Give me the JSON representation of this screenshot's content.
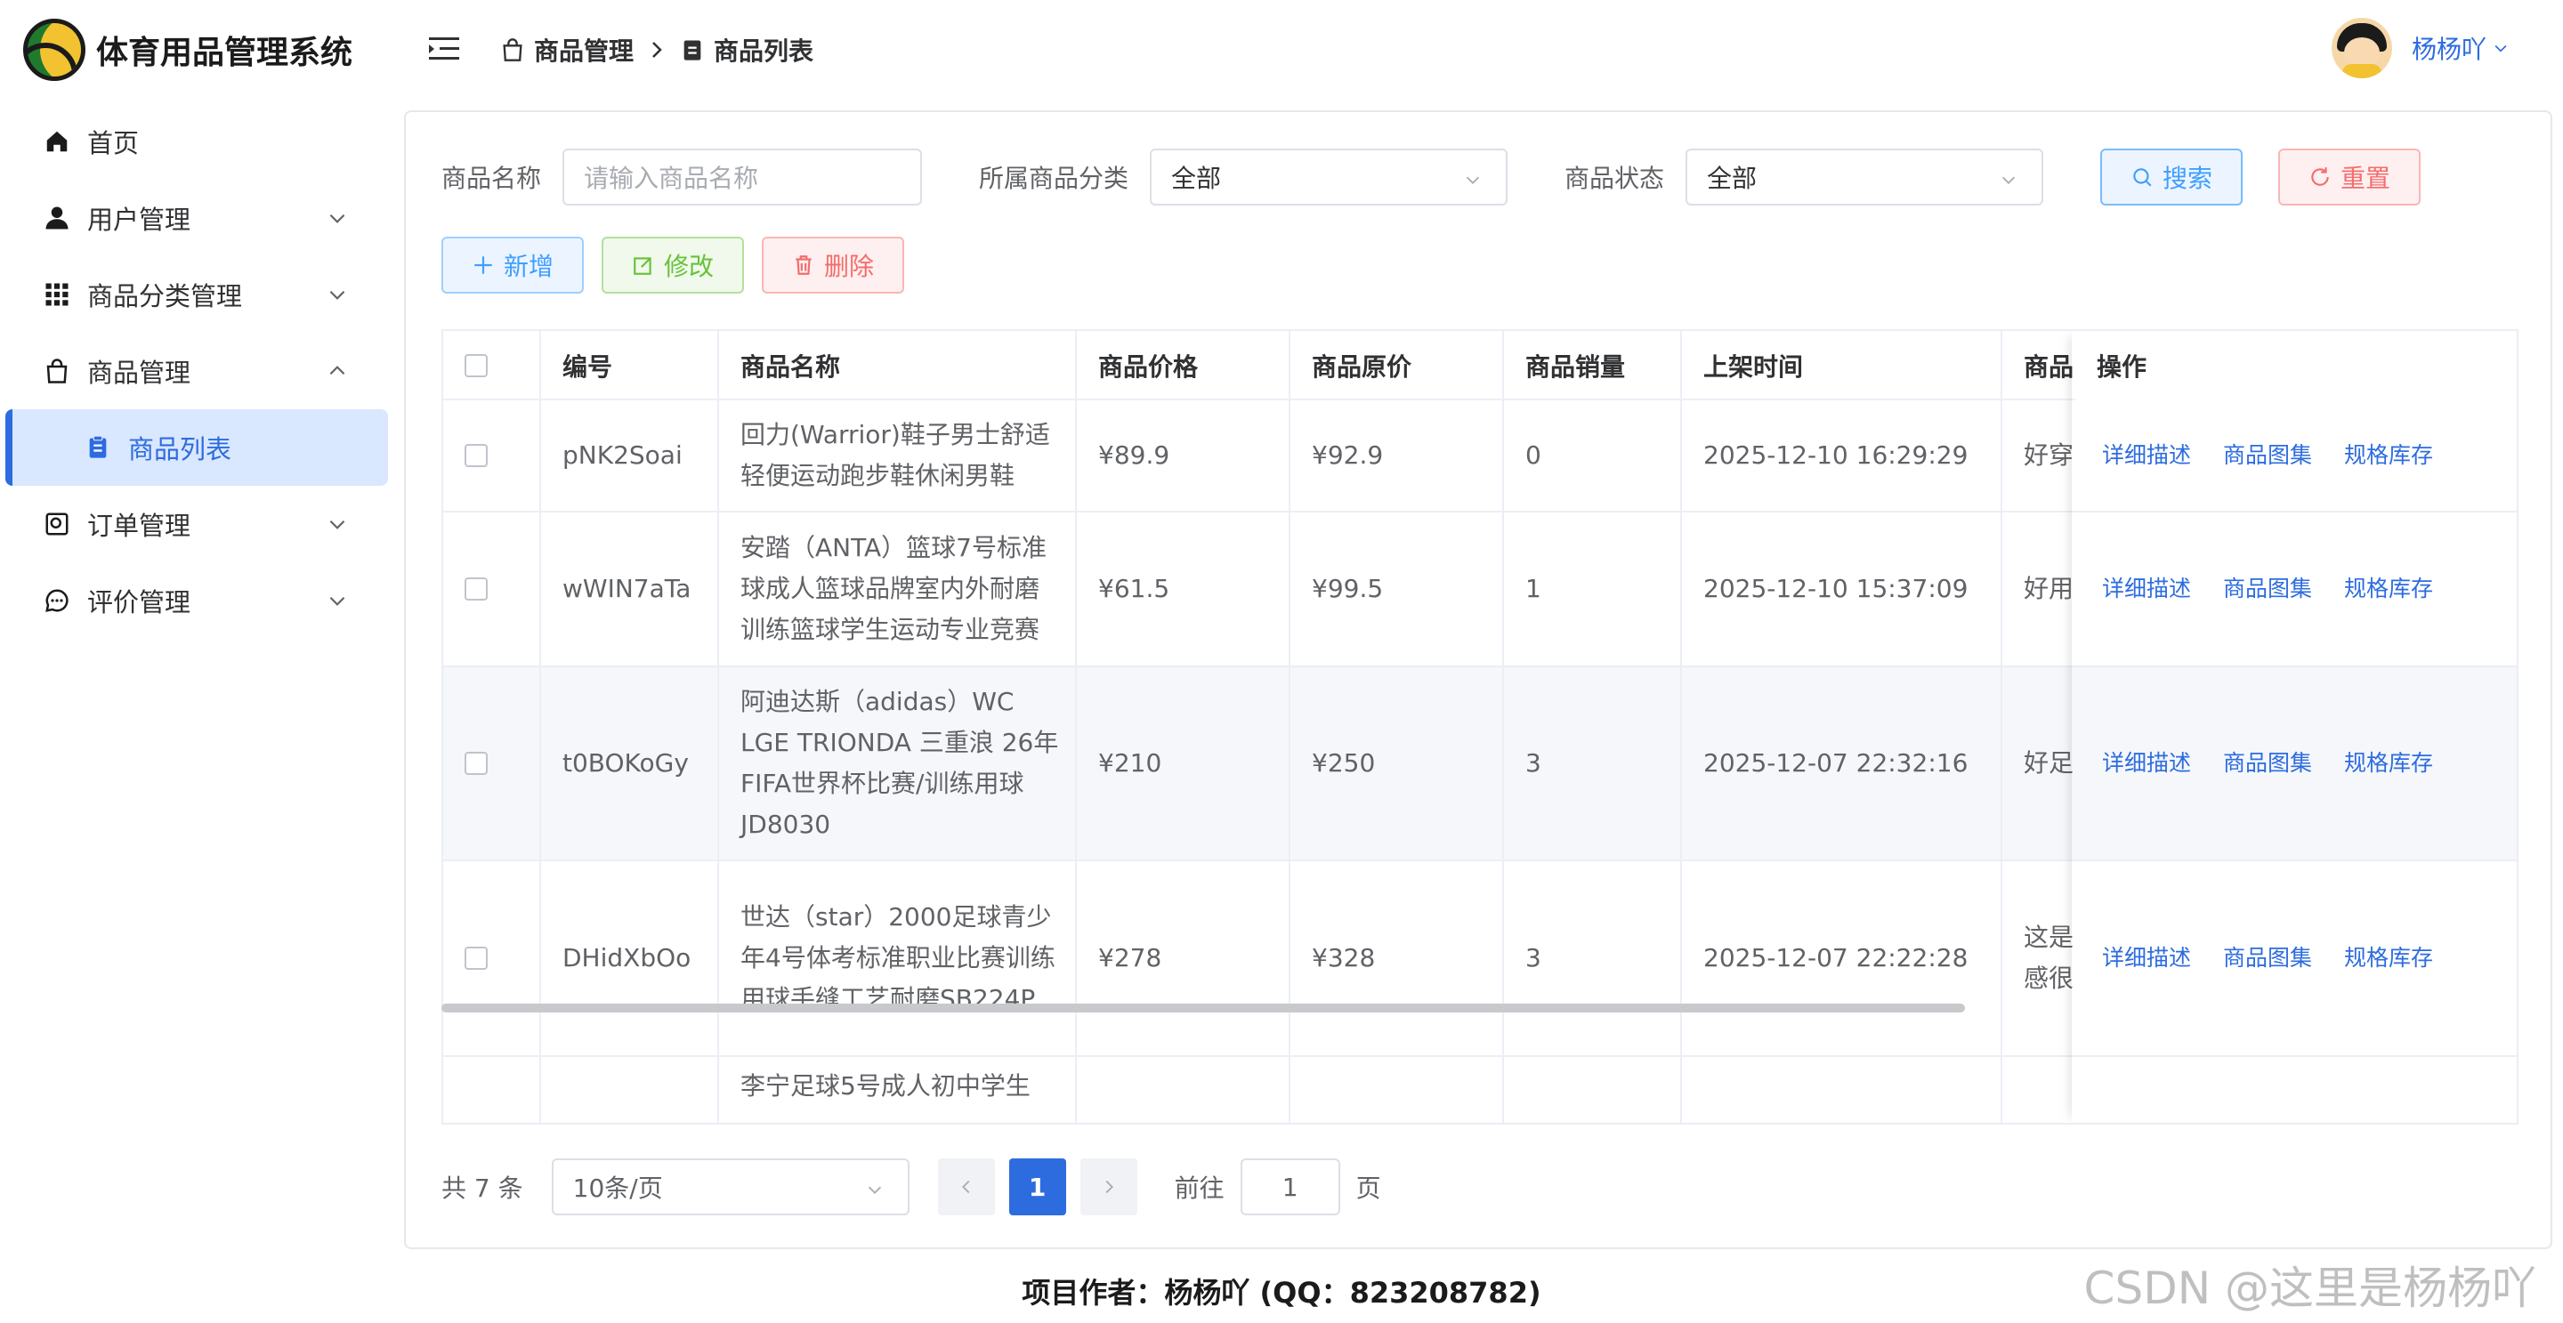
{
  "app": {
    "title": "体育用品管理系统"
  },
  "sidebar": {
    "items": [
      {
        "label": "首页",
        "icon": "home-icon"
      },
      {
        "label": "用户管理",
        "icon": "user-icon"
      },
      {
        "label": "商品分类管理",
        "icon": "grid-icon"
      },
      {
        "label": "商品管理",
        "icon": "shopping-bag-icon"
      },
      {
        "label": "商品列表",
        "icon": "clipboard-icon"
      },
      {
        "label": "订单管理",
        "icon": "order-icon"
      },
      {
        "label": "评价管理",
        "icon": "chat-icon"
      }
    ]
  },
  "header": {
    "breadcrumb": [
      "商品管理",
      "商品列表"
    ],
    "user_name": "杨杨吖"
  },
  "filters": {
    "name_label": "商品名称",
    "name_placeholder": "请输入商品名称",
    "category_label": "所属商品分类",
    "category_value": "全部",
    "status_label": "商品状态",
    "status_value": "全部",
    "search_label": "搜索",
    "reset_label": "重置"
  },
  "toolbar": {
    "add_label": "新增",
    "edit_label": "修改",
    "delete_label": "删除"
  },
  "table": {
    "columns": [
      "编号",
      "商品名称",
      "商品价格",
      "商品原价",
      "商品销量",
      "上架时间",
      "商品",
      "操作"
    ],
    "operations": [
      "详细描述",
      "商品图集",
      "规格库存"
    ],
    "rows": [
      {
        "id": "pNK2Soai",
        "name": "回力(Warrior)鞋子男士舒适轻便运动跑步鞋休闲男鞋",
        "price": "¥89.9",
        "original": "¥92.9",
        "sales": "0",
        "time": "2025-12-10 16:29:29",
        "desc": "好穿"
      },
      {
        "id": "wWIN7aTa",
        "name": "安踏（ANTA）篮球7号标准球成人篮球品牌室内外耐磨训练篮球学生运动专业竞赛",
        "price": "¥61.5",
        "original": "¥99.5",
        "sales": "1",
        "time": "2025-12-10 15:37:09",
        "desc": "好用"
      },
      {
        "id": "t0BOKoGy",
        "name": "阿迪达斯（adidas）WC LGE TRIONDA 三重浪 26年FIFA世界杯比赛/训练用球 JD8030",
        "price": "¥210",
        "original": "¥250",
        "sales": "3",
        "time": "2025-12-07 22:32:16",
        "desc": "好足"
      },
      {
        "id": "DHidXbOo",
        "name": "世达（star）2000足球青少年4号体考标准职业比赛训练用球手缝工艺耐磨SB224P",
        "price": "¥278",
        "original": "¥328",
        "sales": "3",
        "time": "2025-12-07 22:22:28",
        "desc": "这是感很"
      },
      {
        "id": "",
        "name": "李宁足球5号成人初中学生",
        "price": "",
        "original": "",
        "sales": "",
        "time": "",
        "desc": ""
      }
    ]
  },
  "pagination": {
    "total": "共 7 条",
    "page_size": "10条/页",
    "current": "1",
    "goto_label": "前往",
    "goto_value": "1",
    "page_unit": "页"
  },
  "footer": {
    "text": "项目作者：杨杨吖 (QQ：823208782)",
    "watermark": "CSDN @这里是杨杨吖"
  },
  "colors": {
    "primary": "#2d6cdf",
    "success": "#67c23a",
    "danger": "#f56c6c",
    "active_bg": "#d9e7ff"
  }
}
